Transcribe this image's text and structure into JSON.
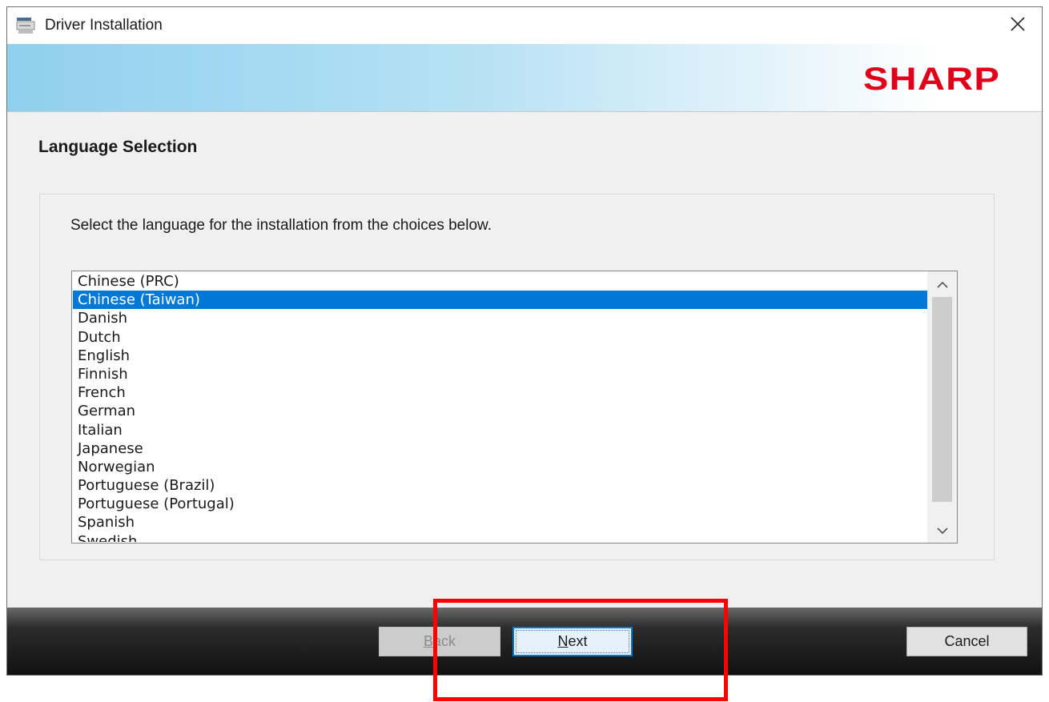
{
  "window": {
    "title": "Driver Installation",
    "close_icon": "close-icon",
    "app_icon": "printer-setup-icon"
  },
  "banner": {
    "brand": "SHARP",
    "brand_color": "#e1001a"
  },
  "page": {
    "heading": "Language Selection",
    "instruction": "Select the language for the installation from the choices below."
  },
  "language_list": {
    "items": [
      "Chinese (PRC)",
      "Chinese (Taiwan)",
      "Danish",
      "Dutch",
      "English",
      "Finnish",
      "French",
      "German",
      "Italian",
      "Japanese",
      "Norwegian",
      "Portuguese (Brazil)",
      "Portuguese (Portugal)",
      "Spanish",
      "Swedish"
    ],
    "selected": "Chinese (Taiwan)",
    "selection_color": "#0078d7",
    "scroll_up_icon": "chevron-up-icon",
    "scroll_down_icon": "chevron-down-icon"
  },
  "footer": {
    "back_label": "Back",
    "next_label": "Next",
    "cancel_label": "Cancel",
    "back_enabled": false
  },
  "annotation": {
    "highlight_color": "#ff0000",
    "highlighted": "next-button"
  }
}
